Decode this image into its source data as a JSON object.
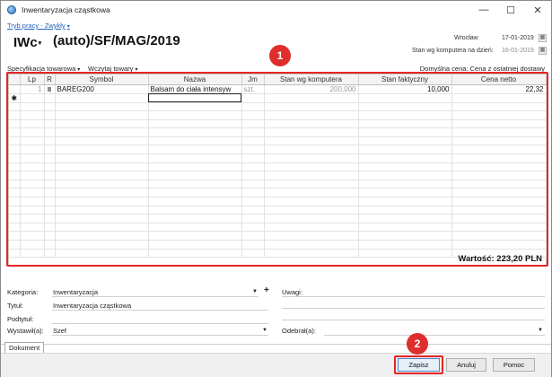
{
  "window": {
    "title": "Inwentaryzacja cząstkowa",
    "minimize": "—",
    "maximize": "☐",
    "close": "✕"
  },
  "mode": {
    "label": "Tryb pracy - Zwykły",
    "caret": "▾"
  },
  "document": {
    "type": "IWc",
    "type_caret": "▾",
    "number": "(auto)/SF/MAG/2019",
    "place": "Wrocław",
    "date": "17-01-2019",
    "stock_label": "Stan wg komputera na dzień:",
    "stock_date": "16-01-2019"
  },
  "toolbar": {
    "spec_label": "Specyfikacja towarowa",
    "load_label": "Wczytaj towary",
    "caret": "▾",
    "default_price": "Domyślna cena: Cena z ostatniej dostawy"
  },
  "grid": {
    "columns": [
      "Lp",
      "R",
      "Symbol",
      "Nazwa",
      "Jm",
      "Stan wg komputera",
      "Stan faktyczny",
      "Cena netto"
    ],
    "rows": [
      {
        "lp": "1",
        "symbol": "BAREG200",
        "name": "Balsam do ciała intensyw",
        "unit": "szt.",
        "computer_stock": "200,000",
        "actual_stock": "10,000",
        "net_price": "22,32"
      }
    ],
    "new_row_marker": "✱",
    "total": "Wartość: 223,20 PLN"
  },
  "annotations": {
    "badge1": "1",
    "badge2": "2"
  },
  "form": {
    "category_label": "Kategoria:",
    "category_value": "Inwentaryzacja",
    "title_label": "Tytuł:",
    "title_value": "Inwentaryzacja cząstkowa",
    "subtitle_label": "Podtytuł:",
    "subtitle_value": "",
    "issued_label": "Wystawił(a):",
    "issued_value": "Szef",
    "notes_label": "Uwagi:",
    "received_label": "Odebrał(a):",
    "received_value": "",
    "dropdown_caret": "▼",
    "plus": "+"
  },
  "tabs": {
    "document": "Dokument"
  },
  "buttons": {
    "save": "Zapisz",
    "cancel": "Anuluj",
    "help": "Pomoc"
  },
  "colors": {
    "highlight": "#e32626",
    "link": "#1f5fbf"
  }
}
